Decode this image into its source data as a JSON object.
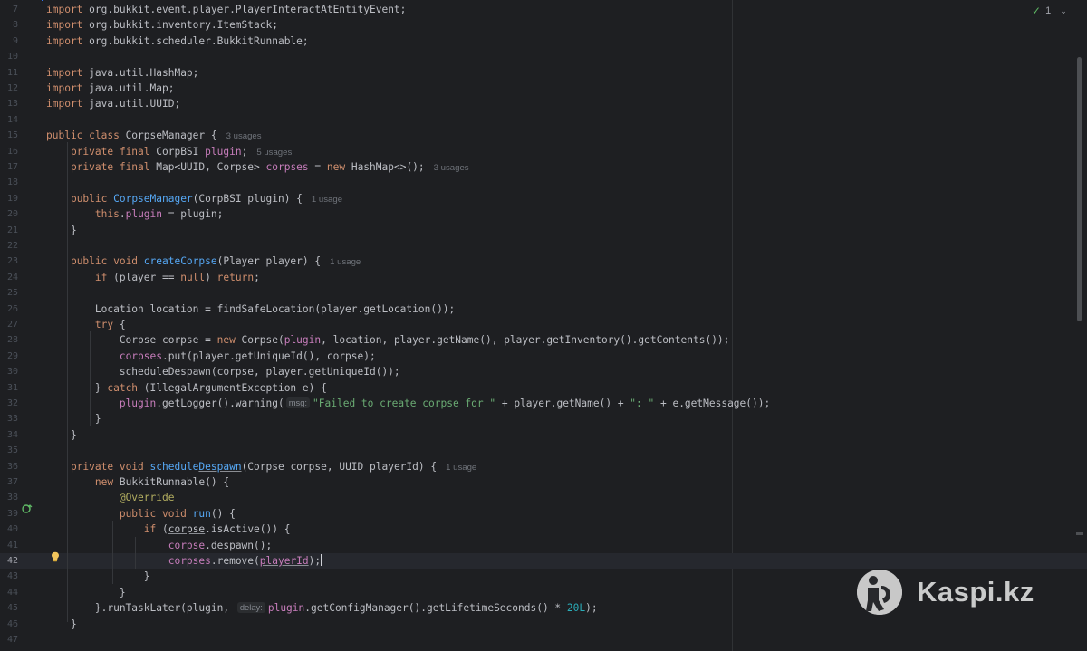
{
  "editor": {
    "status": {
      "warnings_count": "1"
    },
    "lines": [
      {
        "num": "7",
        "segs": [
          [
            "kw",
            "import "
          ],
          [
            "t",
            "org.bukkit.event.player.PlayerInteractAtEntityEvent;"
          ]
        ]
      },
      {
        "num": "8",
        "segs": [
          [
            "kw",
            "import "
          ],
          [
            "t",
            "org.bukkit.inventory.ItemStack;"
          ]
        ]
      },
      {
        "num": "9",
        "segs": [
          [
            "kw",
            "import "
          ],
          [
            "t",
            "org.bukkit.scheduler.BukkitRunnable;"
          ]
        ]
      },
      {
        "num": "10",
        "segs": []
      },
      {
        "num": "11",
        "segs": [
          [
            "kw",
            "import "
          ],
          [
            "t",
            "java.util.HashMap;"
          ]
        ]
      },
      {
        "num": "12",
        "segs": [
          [
            "kw",
            "import "
          ],
          [
            "t",
            "java.util.Map;"
          ]
        ]
      },
      {
        "num": "13",
        "segs": [
          [
            "kw",
            "import "
          ],
          [
            "t",
            "java.util.UUID;"
          ]
        ]
      },
      {
        "num": "14",
        "segs": []
      },
      {
        "num": "15",
        "segs": [
          [
            "kw",
            "public class "
          ],
          [
            "t",
            "CorpseManager {"
          ],
          [
            "hint",
            "3 usages"
          ]
        ]
      },
      {
        "num": "16",
        "segs": [
          [
            "t",
            "    "
          ],
          [
            "kw",
            "private final "
          ],
          [
            "t",
            "CorpBSI "
          ],
          [
            "fld",
            "plugin"
          ],
          [
            "t",
            ";"
          ],
          [
            "hint",
            "5 usages"
          ]
        ]
      },
      {
        "num": "17",
        "segs": [
          [
            "t",
            "    "
          ],
          [
            "kw",
            "private final "
          ],
          [
            "t",
            "Map<UUID, Corpse> "
          ],
          [
            "fld",
            "corpses"
          ],
          [
            "t",
            " = "
          ],
          [
            "kw",
            "new "
          ],
          [
            "t",
            "HashMap<>();"
          ],
          [
            "hint",
            "3 usages"
          ]
        ]
      },
      {
        "num": "18",
        "segs": []
      },
      {
        "num": "19",
        "segs": [
          [
            "t",
            "    "
          ],
          [
            "kw",
            "public "
          ],
          [
            "fn",
            "CorpseManager"
          ],
          [
            "t",
            "(CorpBSI plugin) {"
          ],
          [
            "hint",
            "1 usage"
          ]
        ]
      },
      {
        "num": "20",
        "segs": [
          [
            "t",
            "        "
          ],
          [
            "kw",
            "this"
          ],
          [
            "t",
            "."
          ],
          [
            "fld",
            "plugin"
          ],
          [
            "t",
            " = plugin;"
          ]
        ]
      },
      {
        "num": "21",
        "segs": [
          [
            "t",
            "    }"
          ]
        ]
      },
      {
        "num": "22",
        "segs": []
      },
      {
        "num": "23",
        "segs": [
          [
            "t",
            "    "
          ],
          [
            "kw",
            "public void "
          ],
          [
            "fn",
            "createCorpse"
          ],
          [
            "t",
            "(Player player) {"
          ],
          [
            "hint",
            "1 usage"
          ]
        ]
      },
      {
        "num": "24",
        "segs": [
          [
            "t",
            "        "
          ],
          [
            "kw",
            "if "
          ],
          [
            "t",
            "(player == "
          ],
          [
            "kw",
            "null"
          ],
          [
            "t",
            ") "
          ],
          [
            "kw",
            "return"
          ],
          [
            "t",
            ";"
          ]
        ]
      },
      {
        "num": "25",
        "segs": []
      },
      {
        "num": "26",
        "segs": [
          [
            "t",
            "        Location location = findSafeLocation(player.getLocation());"
          ]
        ]
      },
      {
        "num": "27",
        "segs": [
          [
            "t",
            "        "
          ],
          [
            "kw",
            "try "
          ],
          [
            "t",
            "{"
          ]
        ]
      },
      {
        "num": "28",
        "segs": [
          [
            "t",
            "            Corpse corpse = "
          ],
          [
            "kw",
            "new "
          ],
          [
            "t",
            "Corpse("
          ],
          [
            "fld",
            "plugin"
          ],
          [
            "t",
            ", location, player.getName(), player.getInventory().getContents());"
          ]
        ]
      },
      {
        "num": "29",
        "segs": [
          [
            "t",
            "            "
          ],
          [
            "fld",
            "corpses"
          ],
          [
            "t",
            ".put(player.getUniqueId(), corpse);"
          ]
        ]
      },
      {
        "num": "30",
        "segs": [
          [
            "t",
            "            scheduleDespawn(corpse, player.getUniqueId());"
          ]
        ]
      },
      {
        "num": "31",
        "segs": [
          [
            "t",
            "        } "
          ],
          [
            "kw",
            "catch "
          ],
          [
            "t",
            "(IllegalArgumentException e) {"
          ]
        ]
      },
      {
        "num": "32",
        "segs": [
          [
            "t",
            "            "
          ],
          [
            "fld",
            "plugin"
          ],
          [
            "t",
            ".getLogger().warning("
          ],
          [
            "inlay",
            "msg:"
          ],
          [
            "str",
            "\"Failed to create corpse for \""
          ],
          [
            "t",
            " + player.getName() + "
          ],
          [
            "str",
            "\": \""
          ],
          [
            "t",
            " + e.getMessage());"
          ]
        ]
      },
      {
        "num": "33",
        "segs": [
          [
            "t",
            "        }"
          ]
        ]
      },
      {
        "num": "34",
        "segs": [
          [
            "t",
            "    }"
          ]
        ]
      },
      {
        "num": "35",
        "segs": []
      },
      {
        "num": "36",
        "segs": [
          [
            "t",
            "    "
          ],
          [
            "kw",
            "private void "
          ],
          [
            "fn",
            "schedule"
          ],
          [
            "fn-ul",
            "Despawn"
          ],
          [
            "t",
            "(Corpse corpse, UUID playerId) {"
          ],
          [
            "hint",
            "1 usage"
          ]
        ]
      },
      {
        "num": "37",
        "segs": [
          [
            "t",
            "        "
          ],
          [
            "kw",
            "new "
          ],
          [
            "t",
            "BukkitRunnable() {"
          ]
        ]
      },
      {
        "num": "38",
        "segs": [
          [
            "t",
            "            "
          ],
          [
            "ann",
            "@Override"
          ]
        ]
      },
      {
        "num": "39",
        "segs": [
          [
            "t",
            "            "
          ],
          [
            "kw",
            "public void "
          ],
          [
            "fn",
            "run"
          ],
          [
            "t",
            "() {"
          ]
        ]
      },
      {
        "num": "40",
        "segs": [
          [
            "t",
            "                "
          ],
          [
            "kw",
            "if "
          ],
          [
            "t",
            "("
          ],
          [
            "ul",
            "corpse"
          ],
          [
            "t",
            ".isActive()) {"
          ]
        ]
      },
      {
        "num": "41",
        "segs": [
          [
            "t",
            "                    "
          ],
          [
            "fld-ul",
            "corpse"
          ],
          [
            "t",
            ".despawn();"
          ]
        ]
      },
      {
        "num": "42",
        "segs": [
          [
            "t",
            "                    "
          ],
          [
            "fld",
            "corpses"
          ],
          [
            "t",
            ".remove("
          ],
          [
            "fld-ul",
            "playerId"
          ],
          [
            "t",
            ");"
          ],
          [
            "caret",
            ""
          ]
        ]
      },
      {
        "num": "43",
        "segs": [
          [
            "t",
            "                }"
          ]
        ]
      },
      {
        "num": "44",
        "segs": [
          [
            "t",
            "            }"
          ]
        ]
      },
      {
        "num": "45",
        "segs": [
          [
            "t",
            "        }.runTaskLater("
          ],
          [
            "t",
            "plugin, "
          ],
          [
            "inlay",
            "delay:"
          ],
          [
            "fld",
            "plugin"
          ],
          [
            "t",
            ".getConfigManager().getLifetimeSeconds() * "
          ],
          [
            "num",
            "20L"
          ],
          [
            "t",
            ");"
          ]
        ]
      },
      {
        "num": "46",
        "segs": [
          [
            "t",
            "    }"
          ]
        ]
      },
      {
        "num": "47",
        "segs": []
      }
    ]
  },
  "watermark": {
    "text": "Kaspi.kz"
  },
  "icons": {
    "override": "override-gutter-icon",
    "bulb": "intention-bulb-icon",
    "check": "inspection-ok-icon"
  },
  "colors": {
    "background": "#1e1f22",
    "keyword": "#cf8e6d",
    "function": "#56a8f5",
    "field": "#c77dbb",
    "string": "#6aab73",
    "number": "#2aacb8",
    "annotation": "#b3ae60",
    "text": "#bcbec4"
  }
}
